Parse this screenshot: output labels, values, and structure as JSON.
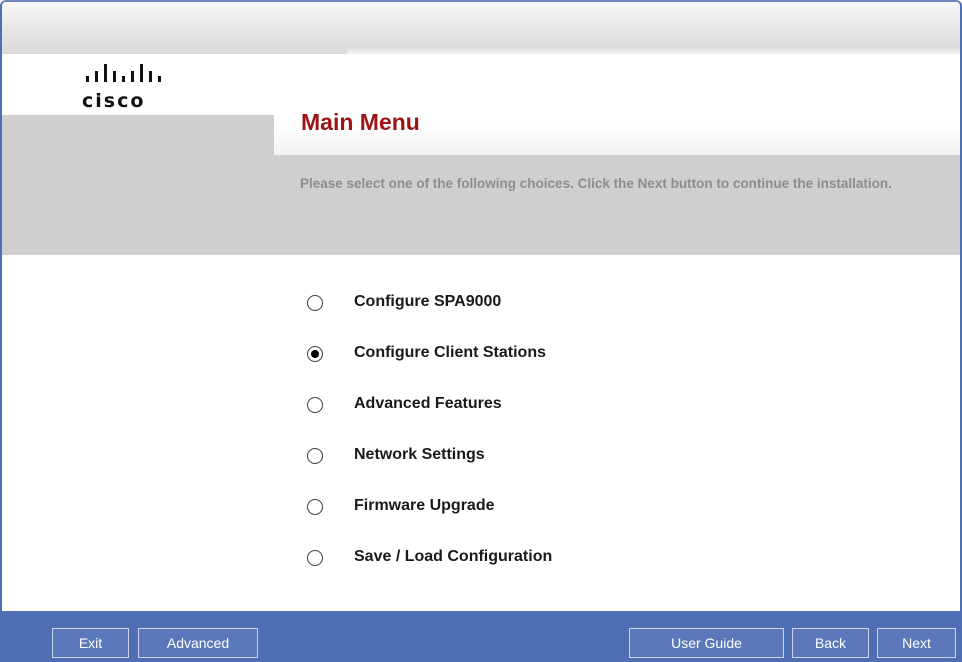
{
  "brand": {
    "logo_text": "cisco",
    "logo_icon": "cisco-bars-logo"
  },
  "main": {
    "title": "Main Menu",
    "instructions": "Please select one of the following choices. Click the Next button to continue the installation.",
    "options": [
      {
        "label": "Configure SPA9000",
        "selected": false
      },
      {
        "label": "Configure Client Stations",
        "selected": true
      },
      {
        "label": "Advanced Features",
        "selected": false
      },
      {
        "label": "Network Settings",
        "selected": false
      },
      {
        "label": "Firmware Upgrade",
        "selected": false
      },
      {
        "label": "Save / Load Configuration",
        "selected": false
      }
    ]
  },
  "footer": {
    "exit_label": "Exit",
    "advanced_label": "Advanced",
    "user_guide_label": "User Guide",
    "back_label": "Back",
    "next_label": "Next"
  },
  "colors": {
    "title": "#9c1414",
    "footer_bar": "#4f6fb4",
    "instructions_text": "#8d8d8d",
    "gray_band": "#cfcfcf"
  }
}
